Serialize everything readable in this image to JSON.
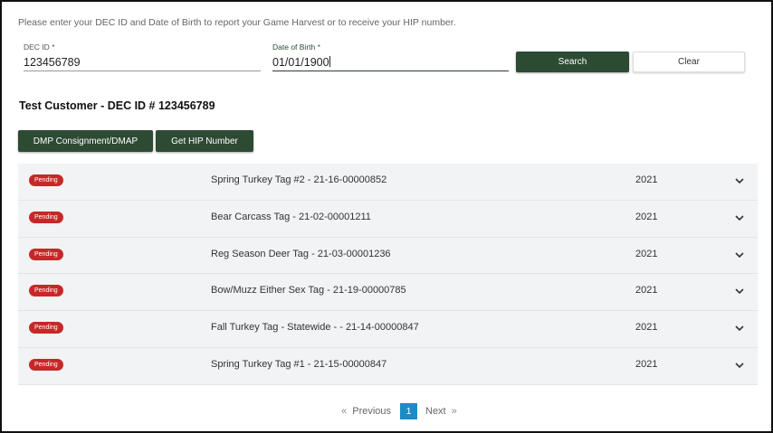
{
  "intro_text": "Please enter your DEC ID and Date of Birth to report your Game Harvest or to receive your HIP number.",
  "form": {
    "dec_id": {
      "label": "DEC ID",
      "required_mark": "*",
      "value": "123456789"
    },
    "dob": {
      "label": "Date of Birth",
      "required_mark": "*",
      "value": "01/01/1900"
    },
    "search_label": "Search",
    "clear_label": "Clear"
  },
  "customer_heading": "Test Customer - DEC ID # 123456789",
  "actions": {
    "dmp_label": "DMP Consignment/DMAP",
    "hip_label": "Get HIP Number"
  },
  "tags": [
    {
      "status": "Pending",
      "name": "Spring Turkey Tag #2 - 21-16-00000852",
      "year": "2021"
    },
    {
      "status": "Pending",
      "name": "Bear Carcass Tag - 21-02-00001211",
      "year": "2021"
    },
    {
      "status": "Pending",
      "name": "Reg Season Deer Tag - 21-03-00001236",
      "year": "2021"
    },
    {
      "status": "Pending",
      "name": "Bow/Muzz Either Sex Tag - 21-19-00000785",
      "year": "2021"
    },
    {
      "status": "Pending",
      "name": "Fall Turkey Tag - Statewide - - 21-14-00000847",
      "year": "2021"
    },
    {
      "status": "Pending",
      "name": "Spring Turkey Tag #1 - 21-15-00000847",
      "year": "2021"
    }
  ],
  "pagination": {
    "prev_arrow": "«",
    "prev_label": "Previous",
    "current_page": "1",
    "next_label": "Next",
    "next_arrow": "»"
  },
  "colors": {
    "primary_green": "#2d4a33",
    "pending_red": "#c62828",
    "page_blue": "#1c8cc8",
    "row_bg": "#f2f3f4"
  },
  "icons": {
    "row_expand": "chevron-down-icon"
  }
}
